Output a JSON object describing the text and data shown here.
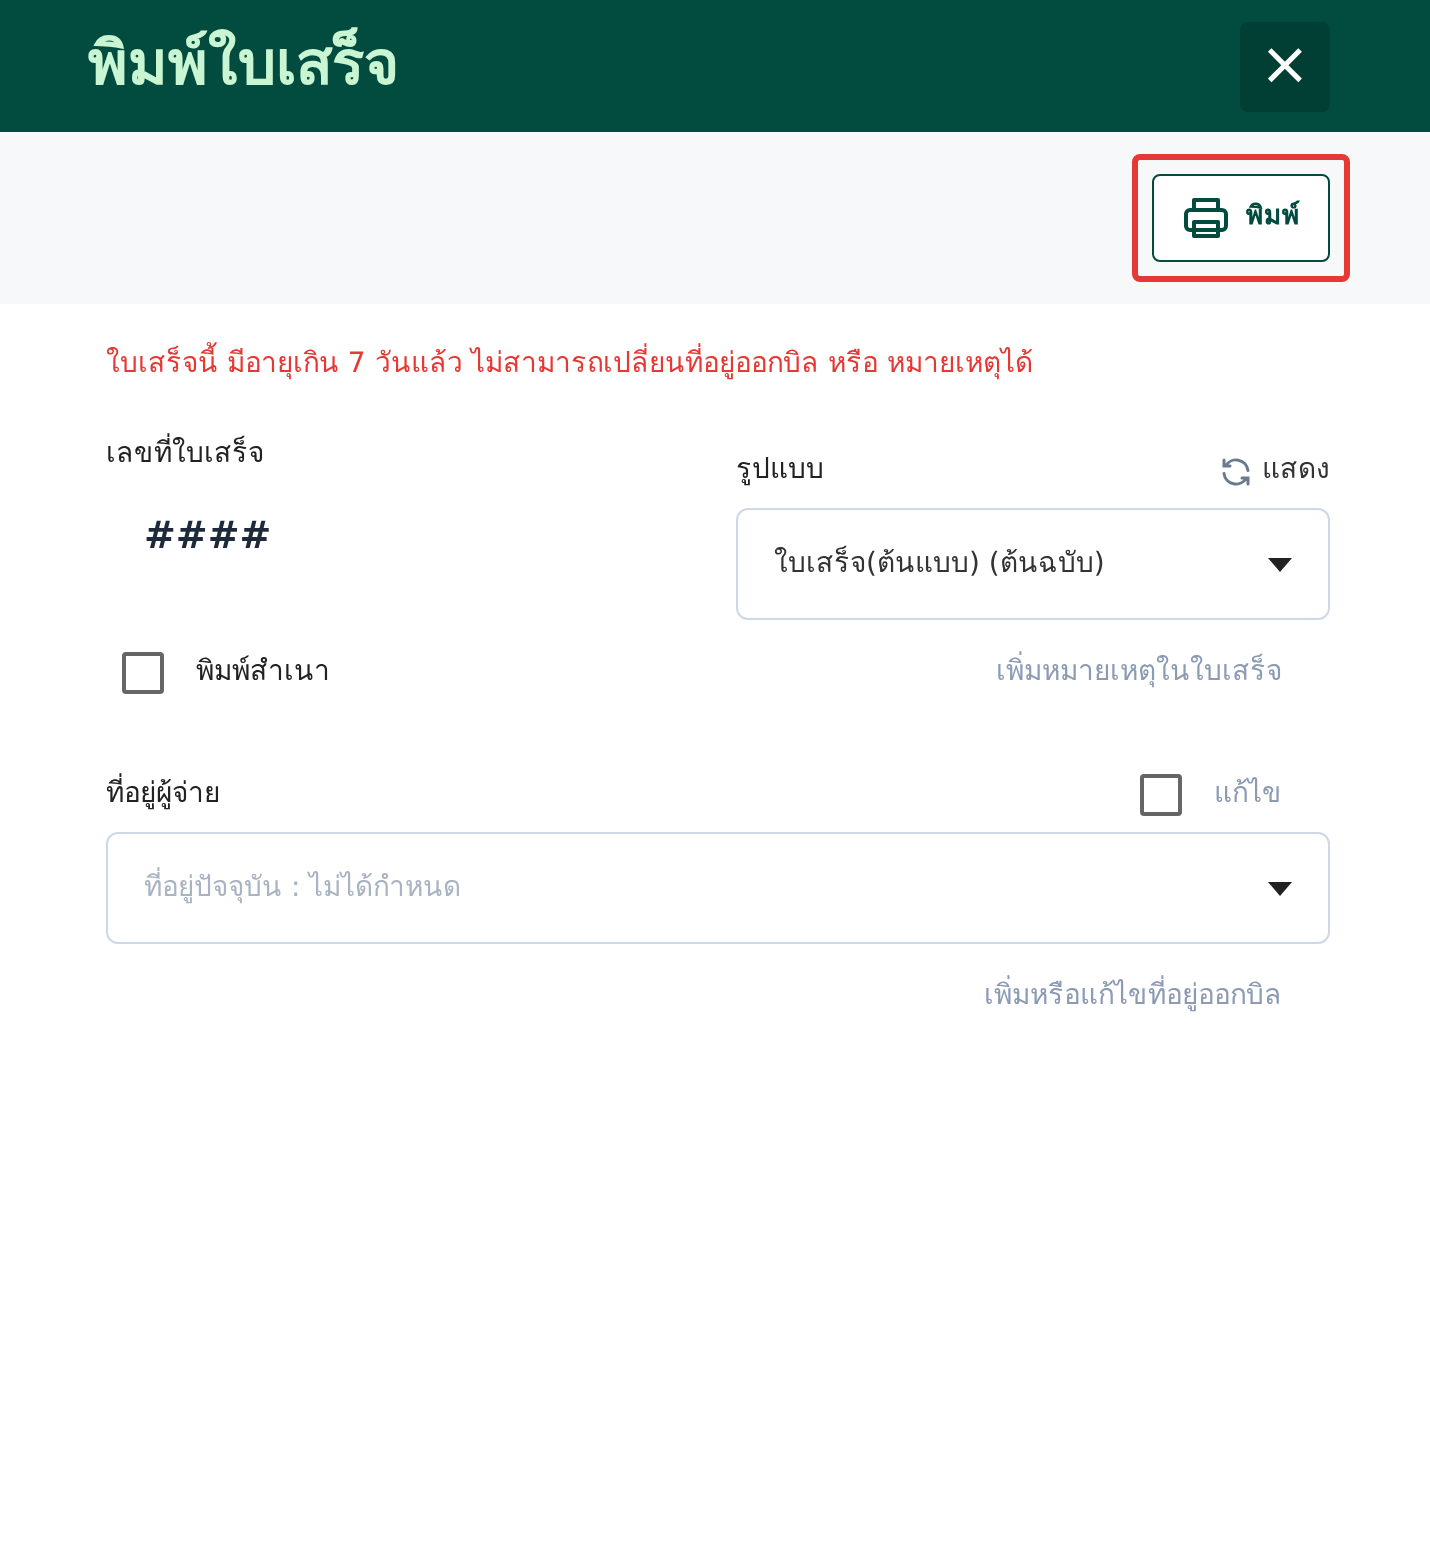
{
  "dialog": {
    "title": "พิมพ์ใบเสร็จ",
    "close": "×"
  },
  "toolbar": {
    "print_button": {
      "label": "พิมพ์",
      "highlighted": true
    }
  },
  "warning": "ใบเสร็จนี้ มีอายุเกิน 7 วันแล้ว ไม่สามารถเปลี่ยนที่อยู่ออกบิล หรือ หมายเหตุได้",
  "receipt_number": {
    "label": "เลขที่ใบเสร็จ",
    "value": "####"
  },
  "format": {
    "label": "รูปแบบ",
    "show_link": "แสดง",
    "value": "ใบเสร็จ(ต้นแบบ) (ต้นฉบับ)"
  },
  "print_copy": {
    "label": "พิมพ์สำเนา",
    "checked": false
  },
  "add_note_link": "เพิ่มหมายเหตุในใบเสร็จ",
  "payer_address": {
    "label": "ที่อยู่ผู้จ่าย",
    "edit": {
      "label": "แก้ไข",
      "checked": false
    },
    "placeholder": "ที่อยู่ปัจจุบัน : ไม่ได้กำหนด"
  },
  "address_link": "เพิ่มหรือแก้ไขที่อยู่ออกบิล"
}
